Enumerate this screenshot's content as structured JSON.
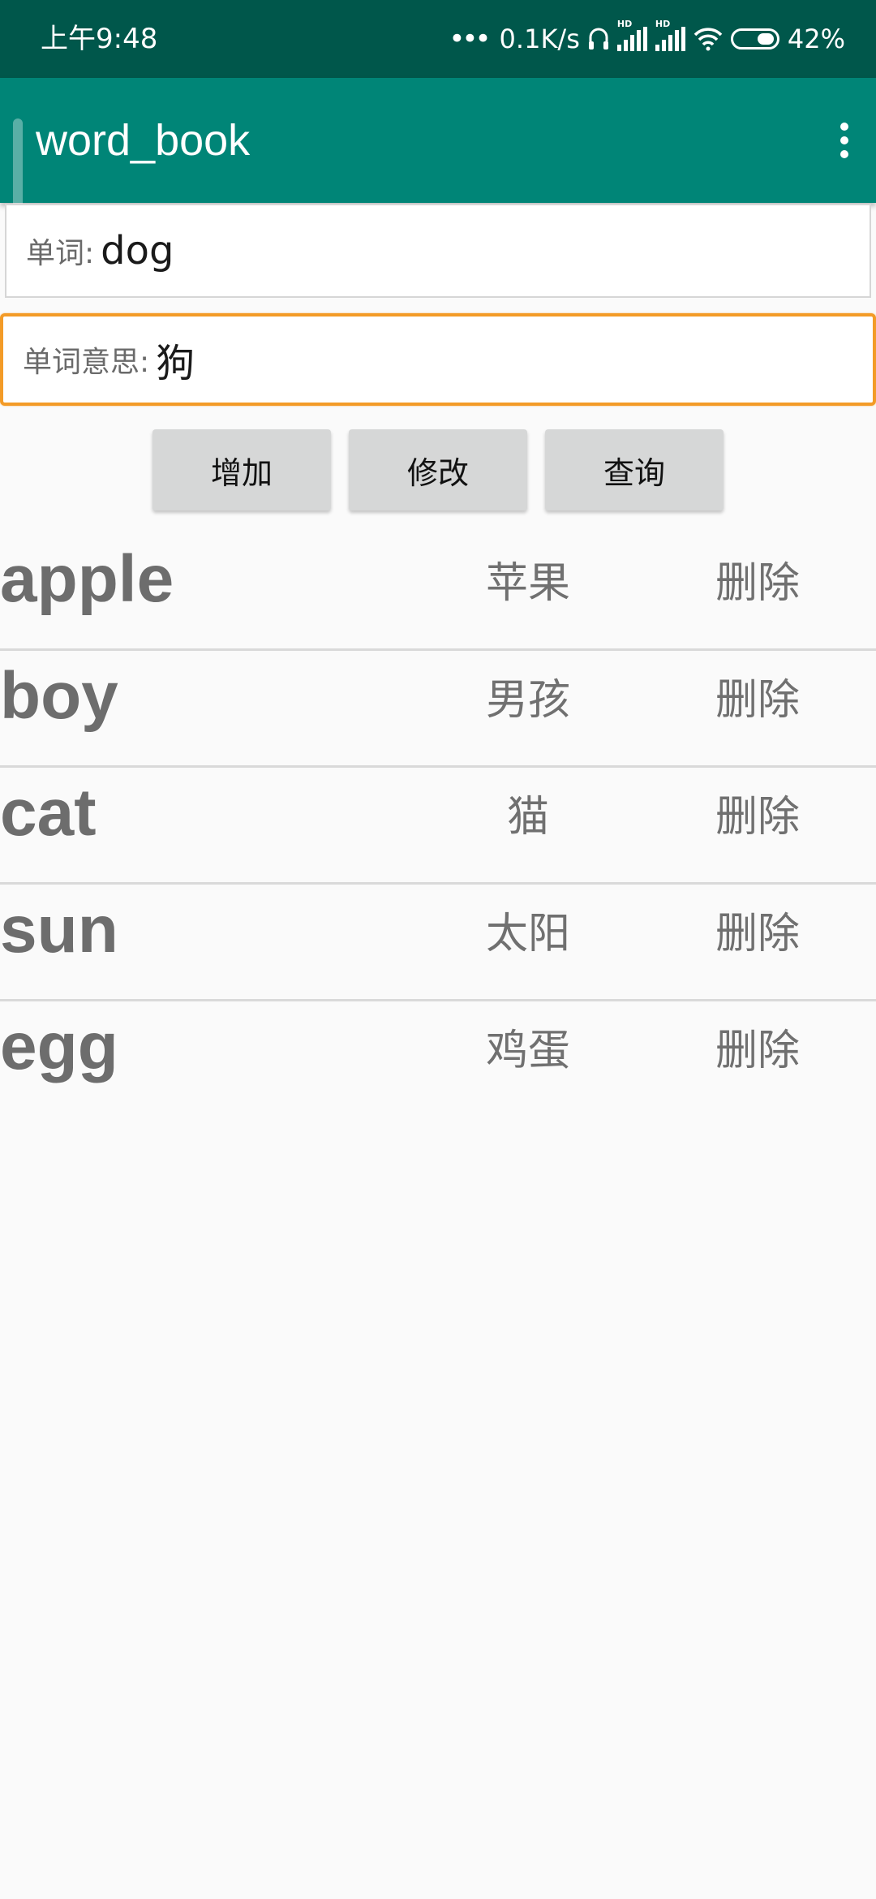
{
  "status_bar": {
    "time": "上午9:48",
    "network_speed": "0.1K/s",
    "battery_percent": "42%",
    "battery_level": 0.42,
    "hd_label": "HD",
    "icons": [
      "more-dots-icon",
      "headset-icon",
      "signal-hd-icon",
      "signal-hd-icon",
      "wifi-icon",
      "battery-icon"
    ]
  },
  "app_bar": {
    "title": "word_book",
    "overflow_icon": "more-vert-icon"
  },
  "form": {
    "word_label": "单词:",
    "word_value": "dog",
    "meaning_label": "单词意思:",
    "meaning_value": "狗"
  },
  "buttons": {
    "add": "增加",
    "edit": "修改",
    "query": "查询"
  },
  "words": [
    {
      "word": "apple",
      "meaning": "苹果",
      "delete": "删除"
    },
    {
      "word": "boy",
      "meaning": "男孩",
      "delete": "删除"
    },
    {
      "word": "cat",
      "meaning": "猫",
      "delete": "删除"
    },
    {
      "word": "sun",
      "meaning": "太阳",
      "delete": "删除"
    },
    {
      "word": "egg",
      "meaning": "鸡蛋",
      "delete": "删除"
    }
  ],
  "colors": {
    "status_bar": "#00574b",
    "app_bar": "#008577",
    "focus_border": "#f39b27",
    "background": "#fafafa"
  }
}
